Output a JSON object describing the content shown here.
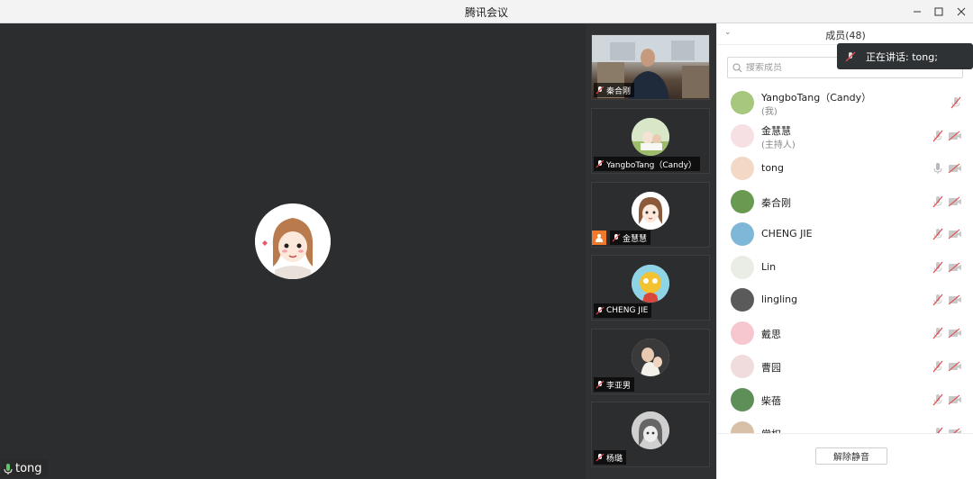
{
  "window": {
    "title": "腾讯会议"
  },
  "main_video": {
    "speaker_name": "tong"
  },
  "thumbnails": [
    {
      "name": "秦合刚",
      "type": "camera"
    },
    {
      "name": "YangboTang（Candy）",
      "type": "avatar"
    },
    {
      "name": "金慧慧",
      "type": "avatar",
      "host": true
    },
    {
      "name": "CHENG JIE",
      "type": "avatar"
    },
    {
      "name": "李亚男",
      "type": "avatar"
    },
    {
      "name": "杨璐",
      "type": "avatar"
    }
  ],
  "members_panel": {
    "title": "成员(48)",
    "search_placeholder": "搜索成员",
    "members": [
      {
        "name": "YangboTang（Candy）",
        "sub": "(我)",
        "mic": "muted",
        "cam": "none"
      },
      {
        "name": "金慧慧",
        "sub": "(主持人)",
        "mic": "muted",
        "cam": "off"
      },
      {
        "name": "tong",
        "sub": "",
        "mic": "on",
        "cam": "off"
      },
      {
        "name": "秦合刚",
        "sub": "",
        "mic": "muted",
        "cam": "off"
      },
      {
        "name": "CHENG JIE",
        "sub": "",
        "mic": "muted",
        "cam": "off"
      },
      {
        "name": "Lin",
        "sub": "",
        "mic": "muted",
        "cam": "off"
      },
      {
        "name": "lingling",
        "sub": "",
        "mic": "muted",
        "cam": "off"
      },
      {
        "name": "戴思",
        "sub": "",
        "mic": "muted",
        "cam": "off"
      },
      {
        "name": "曹园",
        "sub": "",
        "mic": "muted",
        "cam": "off"
      },
      {
        "name": "柴蓓",
        "sub": "",
        "mic": "muted",
        "cam": "off"
      },
      {
        "name": "常权",
        "sub": "",
        "mic": "muted",
        "cam": "off"
      }
    ],
    "unmute_label": "解除静音"
  },
  "toast": {
    "text": "正在讲话: tong;"
  },
  "colors": {
    "accent_orange": "#f07a2a",
    "muted_red": "#e0474c",
    "panel_bg": "#ffffff",
    "video_bg": "#2b2d2e"
  }
}
